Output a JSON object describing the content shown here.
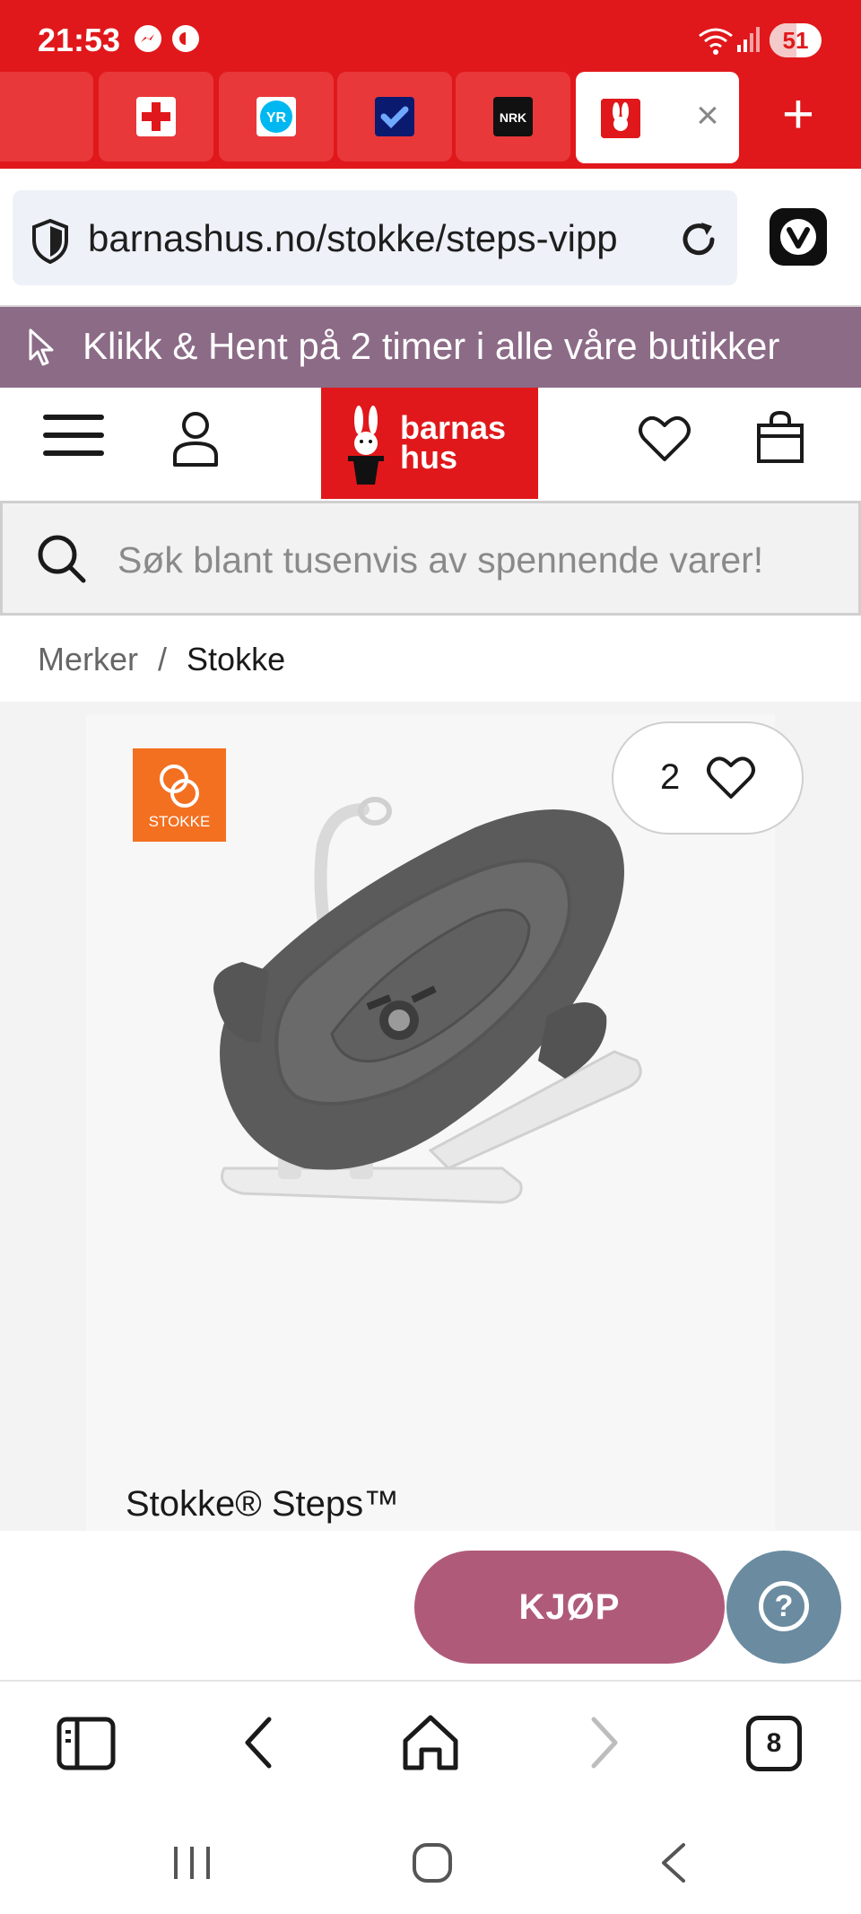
{
  "status_bar": {
    "time": "21:53",
    "battery": "51",
    "battery_level": 0.51,
    "icons": [
      "messenger-icon",
      "sync-icon",
      "wifi-icon",
      "signal-icon",
      "battery-icon"
    ]
  },
  "tabs": {
    "favicons": [
      "red-cross-favicon",
      "yr-favicon",
      "blue-favicon",
      "nrk-favicon",
      "barnashus-favicon"
    ],
    "active_tab_index": 4,
    "new_tab_label": "+"
  },
  "address_bar": {
    "url": "barnashus.no/stokke/steps-vipp"
  },
  "promo": {
    "text": "Klikk & Hent på 2 timer i alle våre butikker"
  },
  "header": {
    "logo_line1": "barnas",
    "logo_line2": "hus"
  },
  "search": {
    "placeholder": "Søk blant tusenvis av spennende varer!"
  },
  "breadcrumb": {
    "items": [
      "Merker",
      "Stokke"
    ],
    "separator": "/"
  },
  "product": {
    "brand_logo_text": "STOKKE",
    "wishlist_count": "2",
    "title": "Stokke® Steps™"
  },
  "actions": {
    "buy_label": "KJØP"
  },
  "browser_toolbar": {
    "tab_count": "8"
  },
  "colors": {
    "browser_red": "#e0181b",
    "promo_purple": "#8c6b87",
    "buy_button": "#b05a7a",
    "help_button": "#6b8ba0",
    "stokke_orange": "#f37021"
  }
}
